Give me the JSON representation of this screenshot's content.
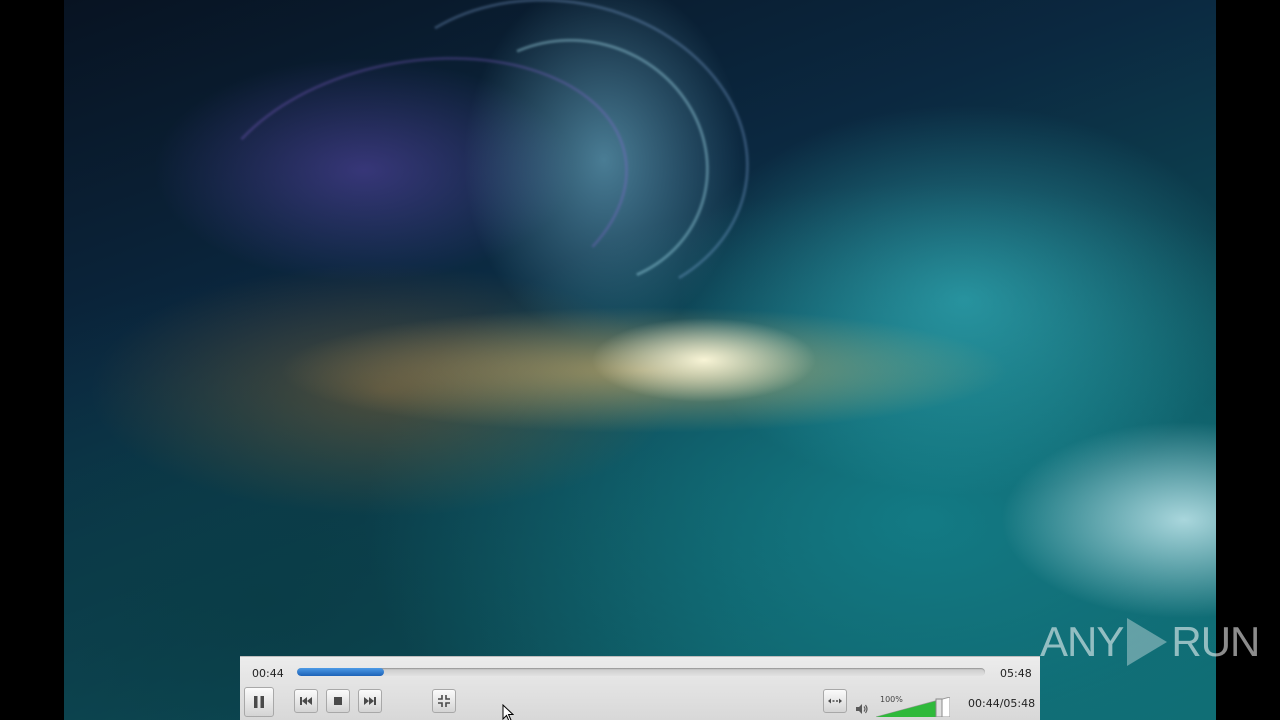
{
  "player": {
    "elapsed": "00:44",
    "total": "05:48",
    "progress_fraction": 0.126,
    "time_readout": "00:44/05:48",
    "volume_label": "100%",
    "volume_fraction": 1.0
  },
  "controls": {
    "pause_icon": "pause-icon",
    "previous_icon": "skip-previous-icon",
    "stop_icon": "stop-icon",
    "next_icon": "skip-next-icon",
    "fullscreen_icon": "fullscreen-exit-icon",
    "loop_icon": "loop-icon",
    "volume_icon": "speaker-icon"
  },
  "watermark": {
    "left": "ANY",
    "right": "RUN"
  },
  "colors": {
    "seek_fill": "#2a73c9",
    "volume_fill": "#2fb93b"
  }
}
